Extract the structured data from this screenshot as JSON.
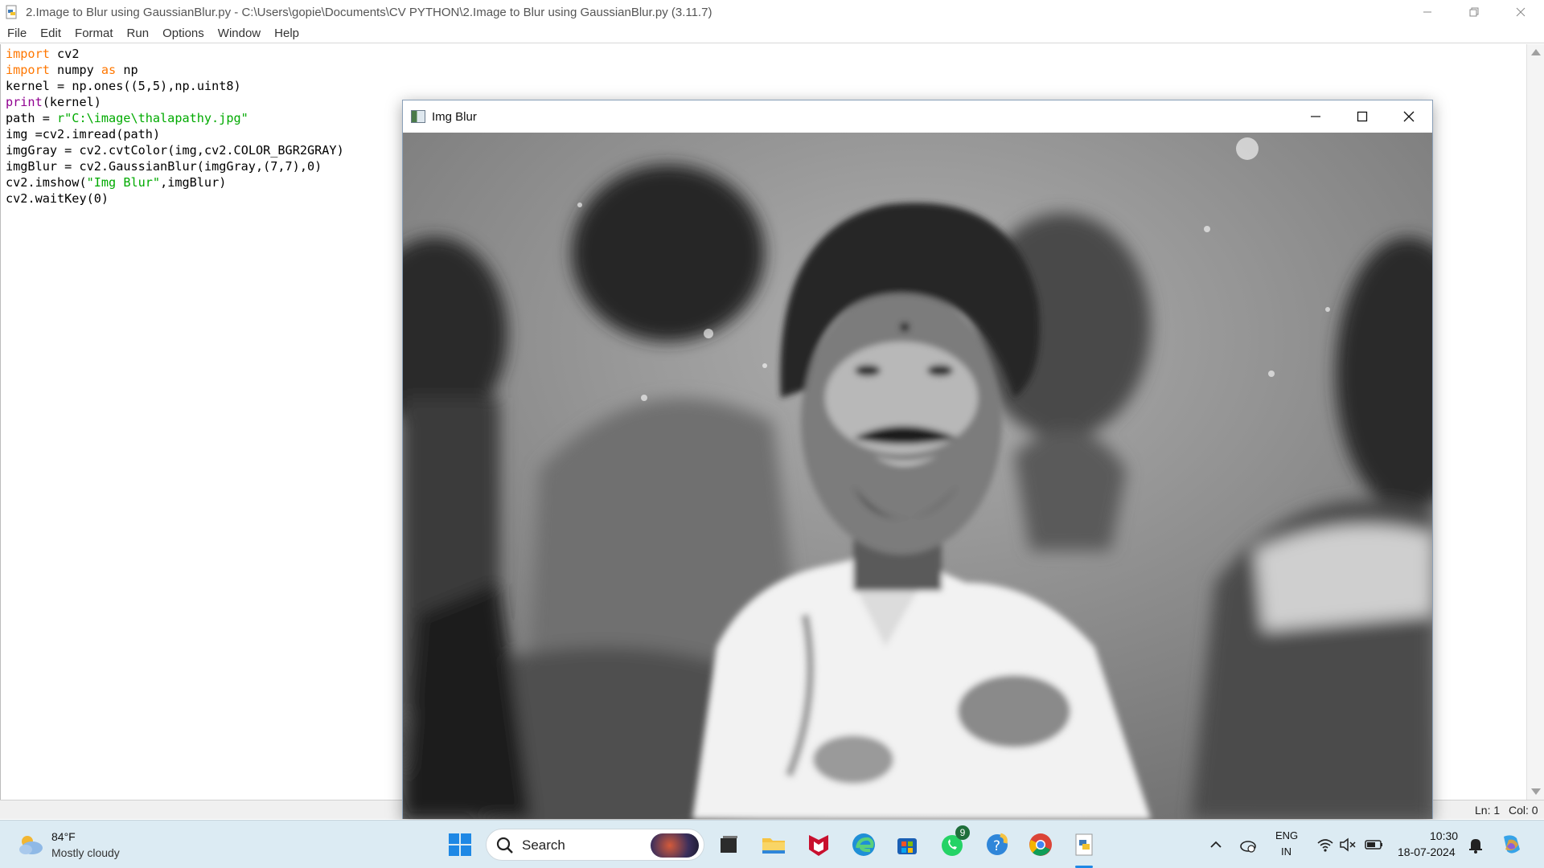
{
  "window": {
    "title": "2.Image to Blur using GaussianBlur.py - C:\\Users\\gopie\\Documents\\CV PYTHON\\2.Image to Blur using GaussianBlur.py (3.11.7)"
  },
  "menu": [
    "File",
    "Edit",
    "Format",
    "Run",
    "Options",
    "Window",
    "Help"
  ],
  "editor": {
    "lines": [
      "import cv2",
      "import numpy as np",
      "kernel = np.ones((5,5),np.uint8)",
      "print(kernel)",
      "path = r\"C:\\image\\thalapathy.jpg\"",
      "img =cv2.imread(path)",
      "imgGray = cv2.cvtColor(img,cv2.COLOR_BGR2GRAY)",
      "imgBlur = cv2.GaussianBlur(imgGray,(7,7),0)",
      "cv2.imshow(\"Img Blur\",imgBlur)",
      "cv2.waitKey(0)"
    ]
  },
  "status": {
    "line": "Ln: 1",
    "col": "Col: 0"
  },
  "image_window": {
    "title": "Img Blur"
  },
  "taskbar": {
    "weather_temp": "84°F",
    "weather_desc": "Mostly cloudy",
    "search_label": "Search",
    "whatsapp_badge": "9",
    "lang_line1": "ENG",
    "lang_line2": "IN",
    "time": "10:30",
    "date": "18-07-2024"
  },
  "colors": {
    "keyword": "#ff7700",
    "builtin": "#900090",
    "string": "#00aa00",
    "taskbar_bg": "#dcebf3"
  }
}
